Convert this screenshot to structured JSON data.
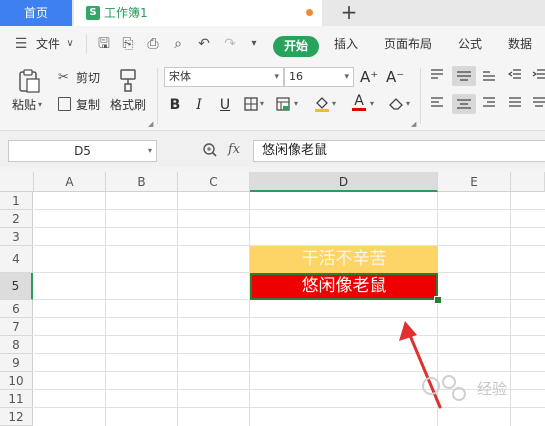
{
  "tabs": {
    "home_label": "首页",
    "workbook_icon": "S",
    "workbook_label": "工作簿1",
    "new_tab": "+"
  },
  "menu": {
    "file": "文件",
    "start": "开始",
    "insert": "插入",
    "page_layout": "页面布局",
    "formula": "公式",
    "data": "数据"
  },
  "ribbon": {
    "paste": "粘贴",
    "cut": "剪切",
    "copy": "复制",
    "format_painter": "格式刷",
    "font_name": "宋体",
    "font_size": "16",
    "bold": "B",
    "italic": "I",
    "underline": "U",
    "grow_font": "A⁺",
    "shrink_font": "A⁻"
  },
  "formula_bar": {
    "name_box": "D5",
    "fx": "fx",
    "value": "悠闲像老鼠"
  },
  "sheet": {
    "columns": [
      "A",
      "B",
      "C",
      "D",
      "E"
    ],
    "rows": [
      "1",
      "2",
      "3",
      "4",
      "5",
      "6",
      "7",
      "8",
      "9",
      "10",
      "11",
      "12"
    ],
    "selected_cell": "D5",
    "cells": {
      "D4": "干活不辛苦",
      "D5": "悠闲像老鼠"
    },
    "colors": {
      "d4_fill": "#fdd466",
      "d5_fill": "#ee0000",
      "selection": "#2e9b59"
    }
  },
  "watermark": "经验"
}
